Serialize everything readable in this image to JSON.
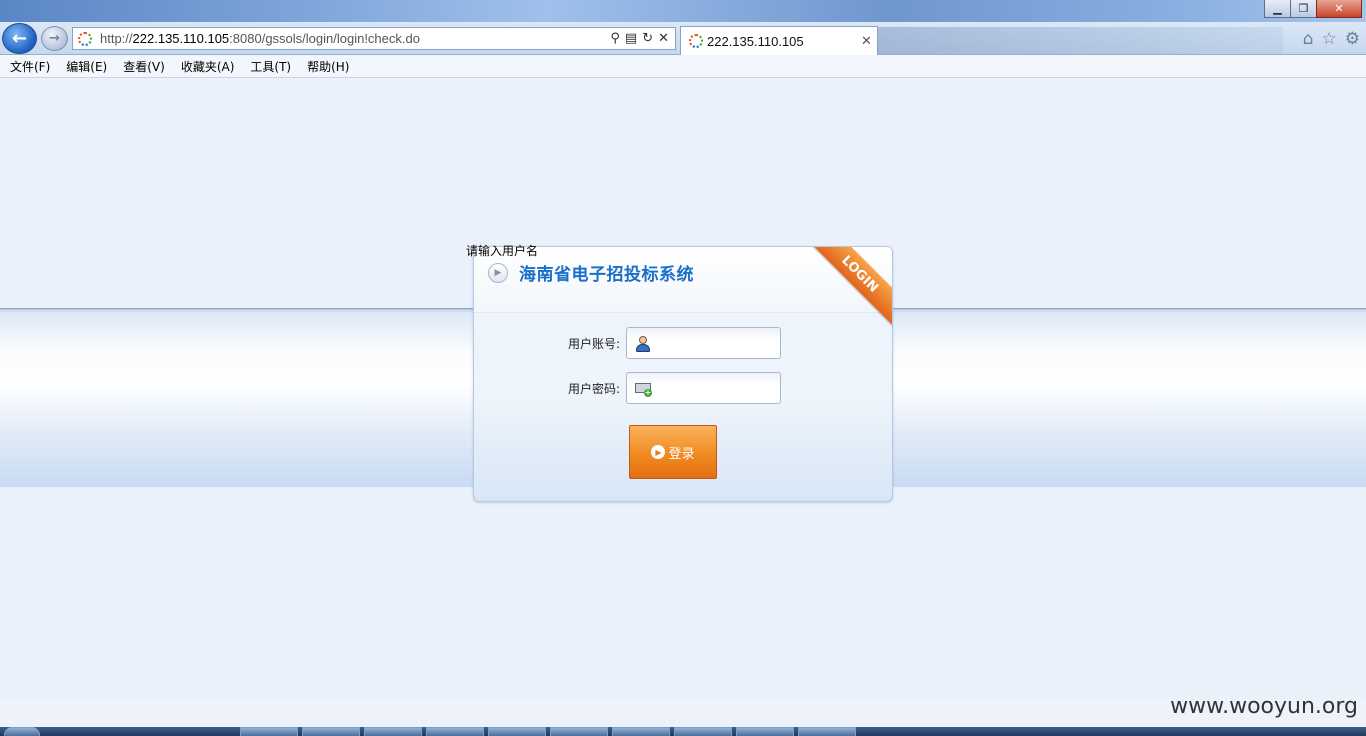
{
  "browser": {
    "window_controls": {
      "minimize": "▁",
      "restore": "❐",
      "close": "✕"
    },
    "nav": {
      "back_icon": "arrow-left",
      "forward_icon": "arrow-right"
    },
    "address": {
      "url_prefix": "http://",
      "url_host": "222.135.110.105",
      "url_rest": ":8080/gssols/login/login!check.do"
    },
    "tab": {
      "title": "222.135.110.105",
      "close": "✕"
    },
    "menu": [
      "文件(F)",
      "编辑(E)",
      "查看(V)",
      "收藏夹(A)",
      "工具(T)",
      "帮助(H)"
    ]
  },
  "page": {
    "hint": "请输入用户名",
    "system_title": "海南省电子招投标系统",
    "ribbon": "LOGIN",
    "username_label": "用户账号:",
    "password_label": "用户密码:",
    "login_button": "登录"
  },
  "watermark": "www.wooyun.org",
  "colors": {
    "title_blue": "#1a6fc9",
    "button_orange": "#f08a22",
    "ribbon_orange": "#e1641a"
  }
}
